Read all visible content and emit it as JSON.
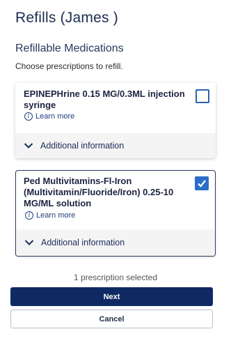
{
  "page": {
    "title": "Refills  (James )"
  },
  "section": {
    "heading": "Refillable Medications",
    "instructions": "Choose prescriptions to refill."
  },
  "medications": [
    {
      "name": "EPINEPHrine 0.15 MG/0.3ML injection syringe",
      "learn_more": "Learn more",
      "additional_info": "Additional information",
      "selected": false
    },
    {
      "name": "Ped Multivitamins-Fl-Iron (Multivitamin/Fluoride/Iron) 0.25-10 MG/ML solution",
      "learn_more": "Learn more",
      "additional_info": "Additional information",
      "selected": true
    }
  ],
  "footer": {
    "selection_count": "1 prescription selected",
    "next_label": "Next",
    "cancel_label": "Cancel"
  },
  "colors": {
    "primary": "#0f2a63",
    "checkbox_checked": "#2a6dc9",
    "text_dark": "#1d2b4f"
  },
  "icons": {
    "info": "info-circle-icon",
    "chevron": "chevron-down-icon",
    "check": "checkmark-icon"
  }
}
